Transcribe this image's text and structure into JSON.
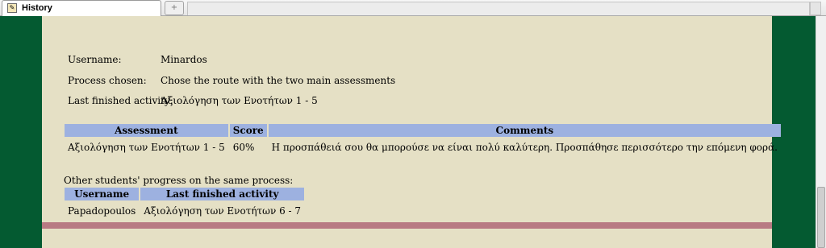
{
  "browser": {
    "tab_title": "History",
    "new_tab_symbol": "+"
  },
  "profile": {
    "username_label": "Username:",
    "username_value": "Minardos",
    "process_label": "Process chosen:",
    "process_value": "Chose the route with the two main assessments",
    "last_activity_label": "Last finished activity:",
    "last_activity_value": "Αξιολόγηση των Ενοτήτων 1 - 5"
  },
  "assessments": {
    "headers": [
      "Assessment",
      "Score",
      "Comments"
    ],
    "rows": [
      {
        "assessment": "Αξιολόγηση των Ενοτήτων 1 - 5",
        "score": "60%",
        "comments": "Η προσπάθειά σου θα μπορούσε να είναι πολύ καλύτερη. Προσπάθησε περισσότερο την επόμενη φορά."
      }
    ]
  },
  "others": {
    "title": "Other students' progress on the same process:",
    "headers": [
      "Username",
      "Last finished activity"
    ],
    "rows": [
      {
        "username": "Papadopoulos",
        "activity": "Αξιολόγηση των Ενοτήτων 6 - 7"
      }
    ]
  }
}
